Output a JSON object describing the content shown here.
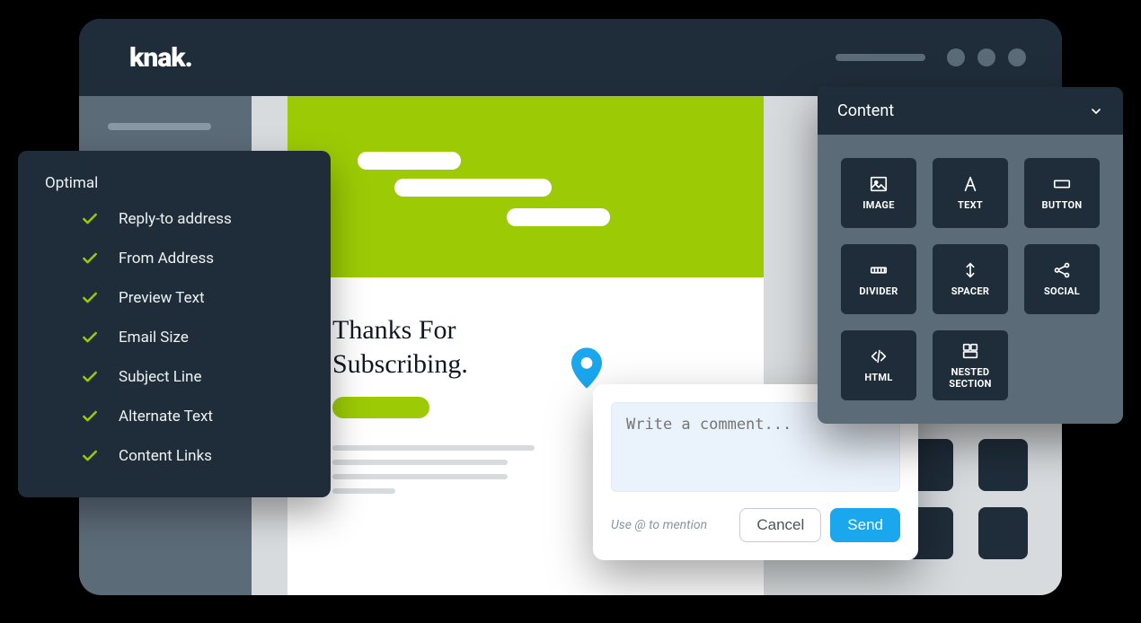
{
  "brand": {
    "logo_text": "knak."
  },
  "optimal": {
    "title": "Optimal",
    "items": [
      {
        "label": "Reply-to address"
      },
      {
        "label": "From Address"
      },
      {
        "label": "Preview Text"
      },
      {
        "label": "Email Size"
      },
      {
        "label": "Subject Line"
      },
      {
        "label": "Alternate Text"
      },
      {
        "label": "Content Links"
      }
    ]
  },
  "email": {
    "heading_line1": "Thanks For",
    "heading_line2": "Subscribing."
  },
  "comment": {
    "placeholder": "Write a comment...",
    "hint": "Use @ to mention",
    "cancel_label": "Cancel",
    "send_label": "Send"
  },
  "content_panel": {
    "title": "Content",
    "blocks": {
      "image": "IMAGE",
      "text": "TEXT",
      "button": "BUTTON",
      "divider": "DIVIDER",
      "spacer": "SPACER",
      "social": "SOCIAL",
      "html": "HTML",
      "nested_section": "NESTED\nSECTION"
    }
  },
  "colors": {
    "accent_green": "#9ccb05",
    "brand_dark": "#1f2d3a",
    "brand_mid": "#5c6b78",
    "link_blue": "#1aa7ee"
  }
}
